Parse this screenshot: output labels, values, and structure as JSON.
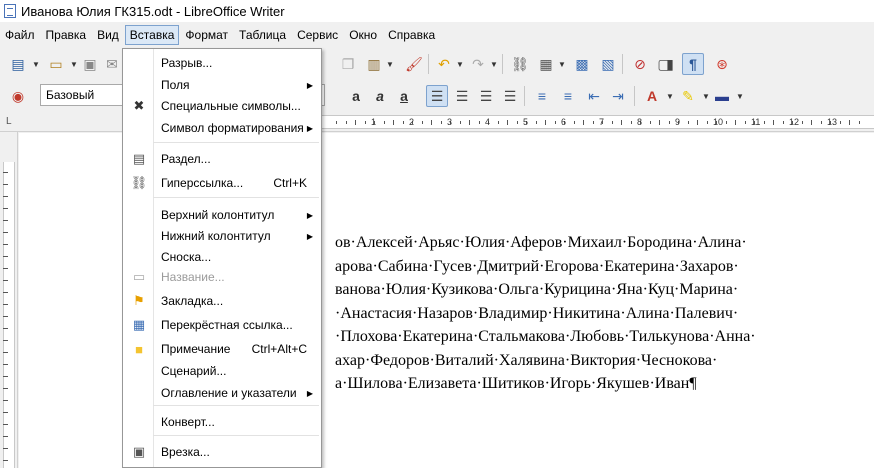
{
  "window": {
    "title": "Иванова Юлия ГК315.odt - LibreOffice Writer"
  },
  "menubar": {
    "items": [
      {
        "label": "Файл"
      },
      {
        "label": "Правка"
      },
      {
        "label": "Вид"
      },
      {
        "label": "Вставка"
      },
      {
        "label": "Формат"
      },
      {
        "label": "Таблица"
      },
      {
        "label": "Сервис"
      },
      {
        "label": "Окно"
      },
      {
        "label": "Справка"
      }
    ],
    "active_index": 3
  },
  "toolbar": {
    "paragraph_style": "Базовый"
  },
  "insert_menu": {
    "items": [
      {
        "label": "Разрыв...",
        "icon": "none",
        "submenu": false,
        "shortcut": "",
        "disabled": false
      },
      {
        "label": "Поля",
        "icon": "none",
        "submenu": true,
        "shortcut": "",
        "disabled": false
      },
      {
        "label": "Специальные символы...",
        "icon": "special-chars-icon",
        "submenu": false,
        "shortcut": "",
        "disabled": false
      },
      {
        "label": "Символ форматирования",
        "icon": "none",
        "submenu": true,
        "shortcut": "",
        "disabled": false
      },
      {
        "label": "Раздел...",
        "icon": "section-icon",
        "submenu": false,
        "shortcut": "",
        "disabled": false
      },
      {
        "label": "Гиперссылка...",
        "icon": "hyperlink-icon",
        "submenu": false,
        "shortcut": "Ctrl+K",
        "disabled": false
      },
      {
        "label": "Верхний колонтитул",
        "icon": "none",
        "submenu": true,
        "shortcut": "",
        "disabled": false
      },
      {
        "label": "Нижний колонтитул",
        "icon": "none",
        "submenu": true,
        "shortcut": "",
        "disabled": false
      },
      {
        "label": "Сноска...",
        "icon": "none",
        "submenu": false,
        "shortcut": "",
        "disabled": false
      },
      {
        "label": "Название...",
        "icon": "caption-icon",
        "submenu": false,
        "shortcut": "",
        "disabled": true
      },
      {
        "label": "Закладка...",
        "icon": "bookmark-icon",
        "submenu": false,
        "shortcut": "",
        "disabled": false
      },
      {
        "label": "Перекрёстная ссылка...",
        "icon": "cross-reference-icon",
        "submenu": false,
        "shortcut": "",
        "disabled": false
      },
      {
        "label": "Примечание",
        "icon": "comment-icon",
        "submenu": false,
        "shortcut": "Ctrl+Alt+C",
        "disabled": false
      },
      {
        "label": "Сценарий...",
        "icon": "none",
        "submenu": false,
        "shortcut": "",
        "disabled": false
      },
      {
        "label": "Оглавление и указатели",
        "icon": "none",
        "submenu": true,
        "shortcut": "",
        "disabled": false
      },
      {
        "label": "Конверт...",
        "icon": "none",
        "submenu": false,
        "shortcut": "",
        "disabled": false
      },
      {
        "label": "Врезка...",
        "icon": "frame-icon",
        "submenu": false,
        "shortcut": "",
        "disabled": false
      }
    ]
  },
  "ruler": {
    "numbers": [
      "1",
      "2",
      "3",
      "4",
      "5",
      "6",
      "7",
      "8",
      "9",
      "10",
      "11",
      "12",
      "13"
    ]
  },
  "document": {
    "lines": [
      "ов·Алексей·Арьяс·Юлия·Аферов·Михаил·Бородина·Алина·",
      "арова·Сабина·Гусев·Дмитрий·Егорова·Екатерина·Захаров·",
      "ванова·Юлия·Кузикова·Ольга·Курицина·Яна·Куц·Марина·",
      "·Анастасия·Назаров·Владимир·Никитина·Алина·Палевич·",
      "·Плохова·Екатерина·Стальмакова·Любовь·Тилькунова·Анна·",
      "ахар·Федоров·Виталий·Халявина·Виктория·Чеснокова·",
      "а·Шилова·Елизавета·Шитиков·Игорь·Якушев·Иван¶"
    ]
  }
}
